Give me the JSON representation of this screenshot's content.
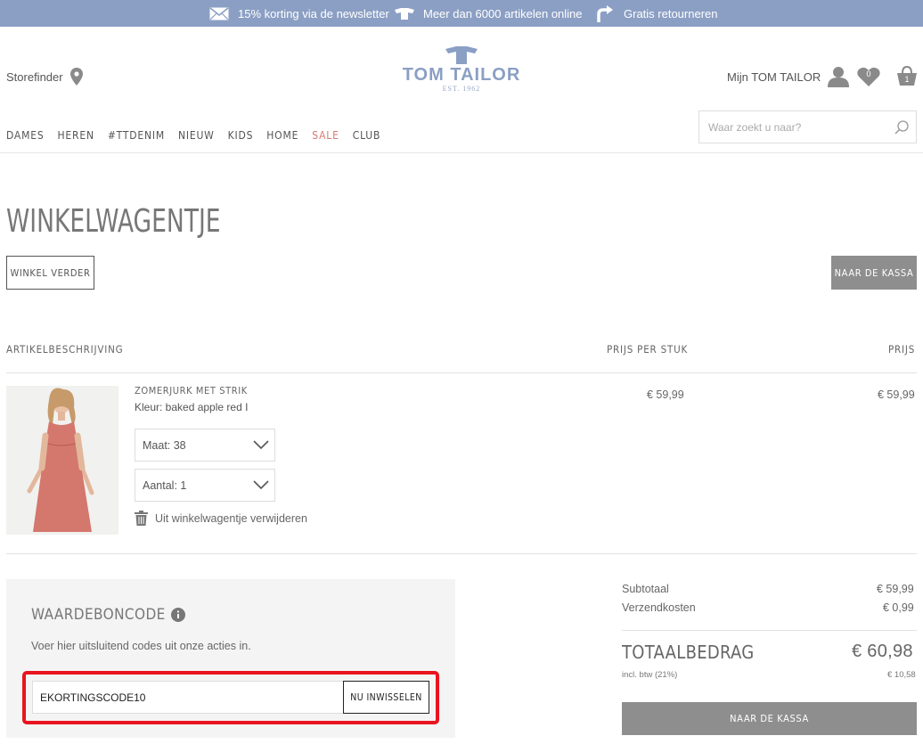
{
  "promo": [
    {
      "icon": "envelope-icon",
      "label": "15% korting via de newsletter"
    },
    {
      "icon": "tshirt-icon",
      "label": "Meer dan 6000 artikelen online"
    },
    {
      "icon": "return-arrow-icon",
      "label": "Gratis retourneren"
    }
  ],
  "header": {
    "storefinder": "Storefinder",
    "logo_brand": "TOM TAILOR",
    "logo_est": "EST. 1962",
    "account": "Mijn TOM TAILOR",
    "wishlist_count": "0",
    "cart_count": "1"
  },
  "nav": [
    "DAMES",
    "HEREN",
    "#TTDENIM",
    "NIEUW",
    "KIDS",
    "HOME",
    "SALE",
    "CLUB"
  ],
  "search": {
    "placeholder": "Waar zoekt u naar?"
  },
  "page": {
    "title": "WINKELWAGENTJE",
    "continue_label": "WINKEL VERDER",
    "checkout_label": "NAAR DE KASSA"
  },
  "table": {
    "col_description": "ARTIKELBESCHRIJVING",
    "col_unit_price": "PRIJS PER STUK",
    "col_price": "PRIJS"
  },
  "item": {
    "name": "ZOMERJURK MET STRIK",
    "color": "Kleur: baked apple red I",
    "size": "Maat: 38",
    "quantity": "Aantal: 1",
    "remove": "Uit winkelwagentje verwijderen",
    "unit_price": "€ 59,99",
    "price": "€ 59,99"
  },
  "voucher": {
    "title": "WAARDEBONCODE",
    "text": "Voer hier uitsluitend codes uit onze acties in.",
    "code": "EKORTINGSCODE10",
    "button": "NU INWISSELEN"
  },
  "totals": {
    "subtotal_label": "Subtotaal",
    "subtotal": "€ 59,99",
    "shipping_label": "Verzendkosten",
    "shipping": "€ 0,99",
    "total_label": "TOTAALBEDRAG",
    "total": "€ 60,98",
    "vat_label": "incl. btw (21%)",
    "vat": "€ 10,58",
    "checkout_label": "NAAR DE KASSA"
  },
  "colors": {
    "promo_bg": "#8b9fc4",
    "sale": "#d67a72",
    "button_gray": "#8e8e8e",
    "highlight": "#e8141f"
  }
}
